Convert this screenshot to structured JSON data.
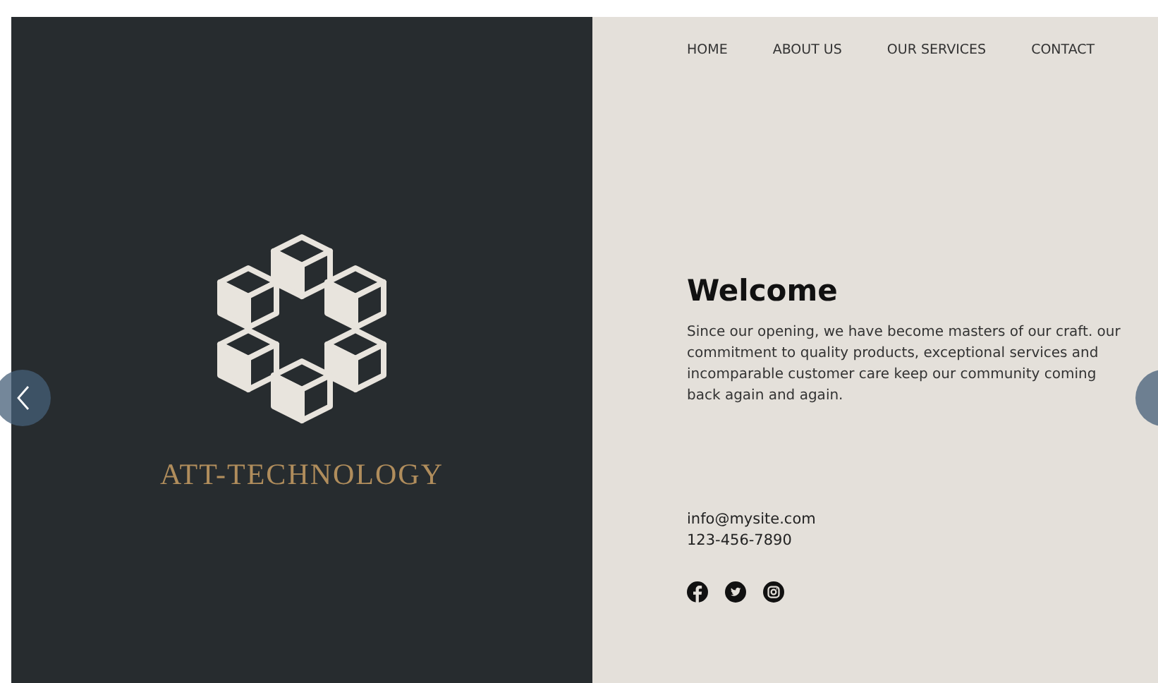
{
  "brand": {
    "name": "ATT-TECHNOLOGY"
  },
  "nav": [
    "HOME",
    "ABOUT US",
    "OUR SERVICES",
    "CONTACT"
  ],
  "welcome": {
    "title": "Welcome",
    "body": "Since our opening, we have become masters of our craft. our commitment to quality products, exceptional services and incomparable customer care keep our community coming back again and again."
  },
  "contact": {
    "email": "info@mysite.com",
    "phone": "123-456-7890"
  },
  "social": [
    {
      "kind": "facebook"
    },
    {
      "kind": "twitter"
    },
    {
      "kind": "instagram"
    }
  ]
}
